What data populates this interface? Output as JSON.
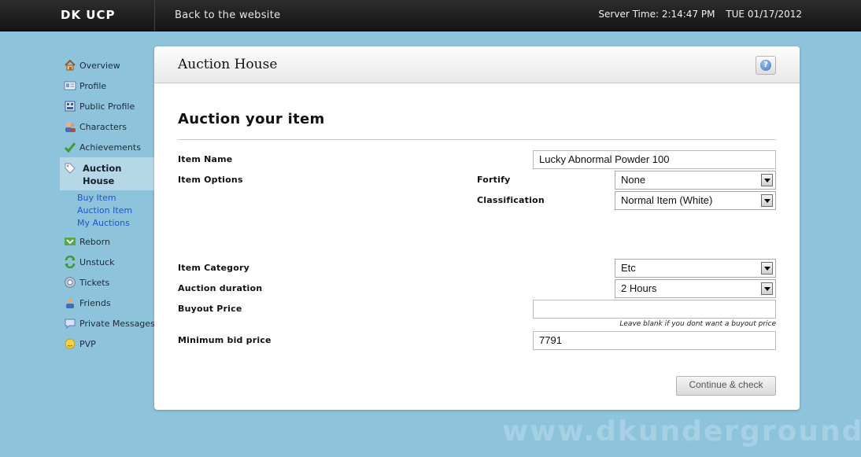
{
  "topbar": {
    "brand": "DK UCP",
    "back_link": "Back to the website",
    "server_time_label": "Server Time: 2:14:47 PM",
    "date": "TUE 01/17/2012"
  },
  "sidebar": {
    "items": [
      {
        "label": "Overview",
        "icon": "home-icon"
      },
      {
        "label": "Profile",
        "icon": "profile-card-icon"
      },
      {
        "label": "Public Profile",
        "icon": "public-profile-icon"
      },
      {
        "label": "Characters",
        "icon": "characters-icon"
      },
      {
        "label": "Achievements",
        "icon": "checkmark-icon"
      },
      {
        "label": "Auction House",
        "icon": "tag-icon"
      },
      {
        "label": "Reborn",
        "icon": "reborn-icon"
      },
      {
        "label": "Unstuck",
        "icon": "unstuck-icon"
      },
      {
        "label": "Tickets",
        "icon": "tickets-icon"
      },
      {
        "label": "Friends",
        "icon": "friends-icon"
      },
      {
        "label": "Private Messages",
        "icon": "speech-bubble-icon"
      },
      {
        "label": "PVP",
        "icon": "pvp-icon"
      }
    ],
    "auction_sub": [
      "Buy Item",
      "Auction Item",
      "My Auctions"
    ]
  },
  "panel": {
    "title": "Auction House",
    "help_symbol": "?"
  },
  "form": {
    "heading": "Auction your item",
    "item_name_label": "Item Name",
    "item_name_value": "Lucky Abnormal Powder 100",
    "item_options_label": "Item Options",
    "fortify_label": "Fortify",
    "fortify_value": "None",
    "classification_label": "Classification",
    "classification_value": "Normal Item (White)",
    "category_label": "Item Category",
    "category_value": "Etc",
    "duration_label": "Auction duration",
    "duration_value": "2 Hours",
    "buyout_label": "Buyout Price",
    "buyout_value": "",
    "buyout_hint": "Leave blank if you dont want a buyout price",
    "min_bid_label": "Minimum bid price",
    "min_bid_value": "7791",
    "submit_label": "Continue & check"
  },
  "watermark": "www.dkunderground.org"
}
